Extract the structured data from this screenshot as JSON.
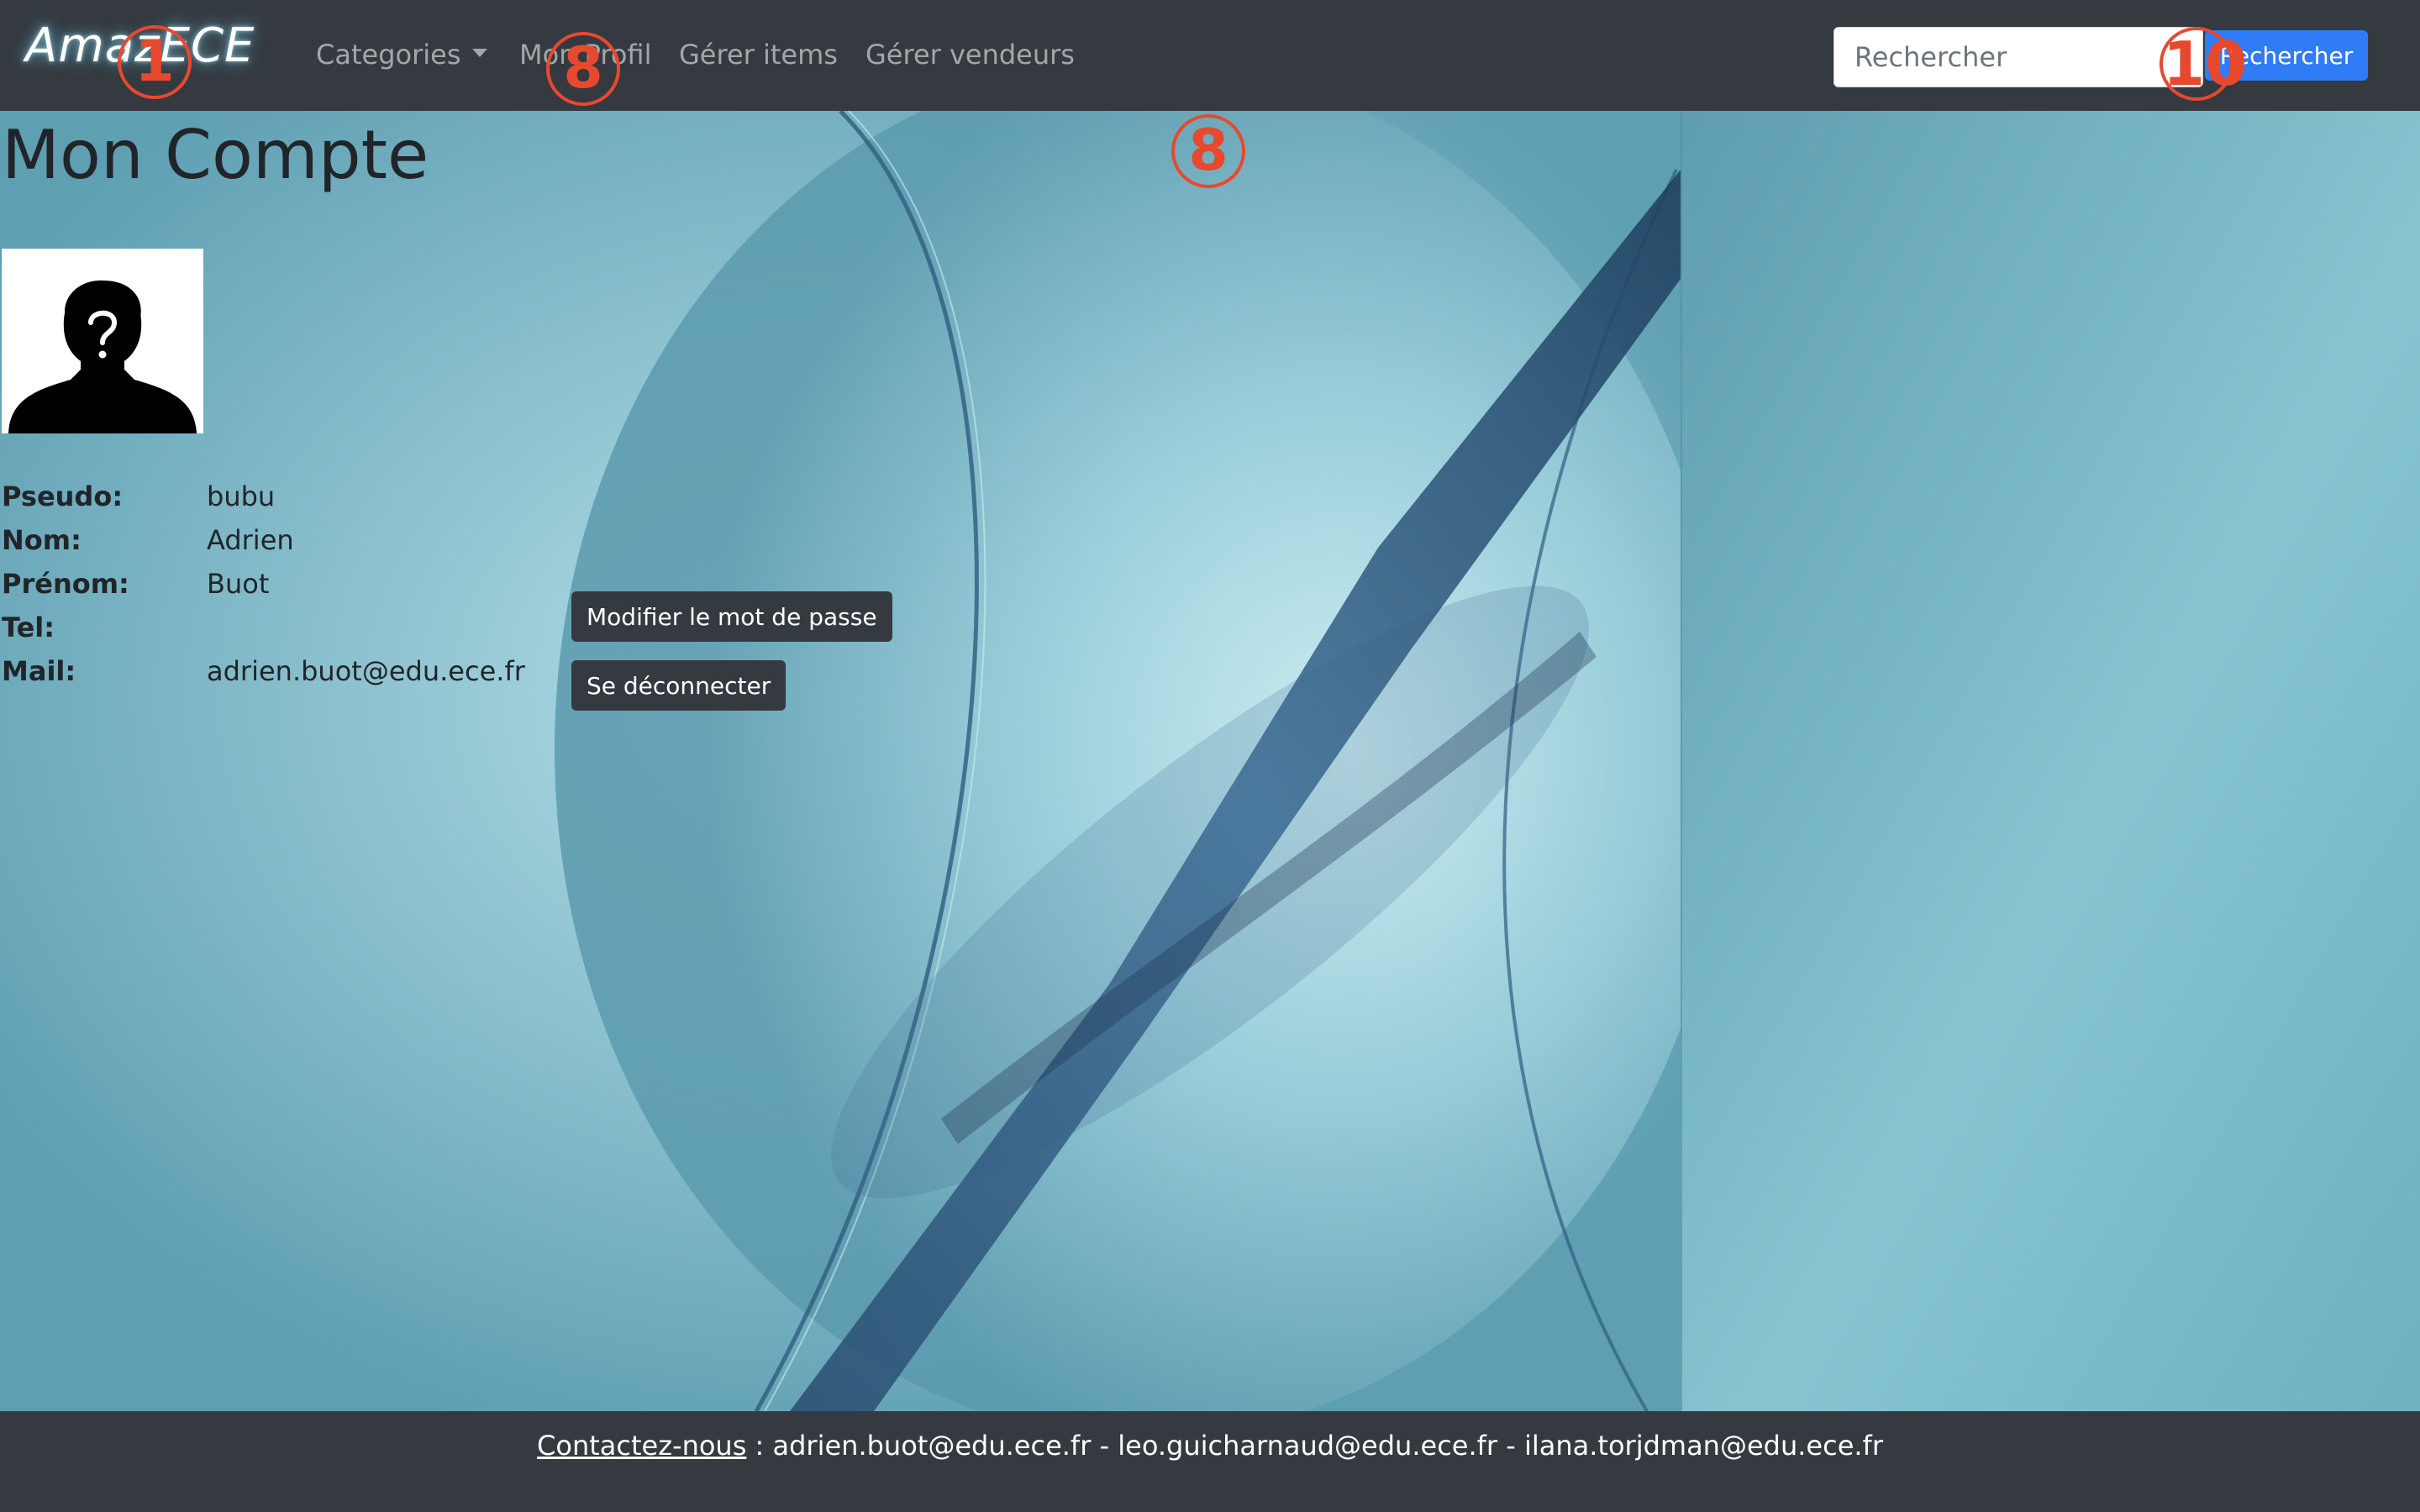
{
  "navbar": {
    "brand": "AmazECE",
    "links": {
      "categories": "Categories",
      "profil": "Mon Profil",
      "items": "Gérer items",
      "vendeurs": "Gérer vendeurs"
    },
    "search": {
      "placeholder": "Rechercher",
      "value": "",
      "button_label": "Rechercher"
    }
  },
  "markers": [
    "1",
    "8",
    "8",
    "10"
  ],
  "account": {
    "title": "Mon Compte",
    "avatar_icon": "unknown-user-silhouette-icon",
    "fields": {
      "pseudo": {
        "label": "Pseudo:",
        "value": "bubu"
      },
      "nom": {
        "label": "Nom:",
        "value": "Adrien"
      },
      "prenom": {
        "label": "Prénom:",
        "value": "Buot"
      },
      "tel": {
        "label": "Tel:",
        "value": ""
      },
      "mail": {
        "label": "Mail:",
        "value": "adrien.buot@edu.ece.fr"
      }
    },
    "buttons": {
      "change_password": "Modifier le mot de passe",
      "logout": "Se déconnecter"
    }
  },
  "footer": {
    "contact_link": "Contactez-nous",
    "emails_text": " : adrien.buot@edu.ece.fr - leo.guicharnaud@edu.ece.fr - ilana.torjdman@edu.ece.fr"
  },
  "colors": {
    "navbar_bg": "#343a40",
    "accent_blue": "#2f7cf6",
    "marker_red": "#e8492e",
    "background_teal": "#6aa8b8"
  }
}
